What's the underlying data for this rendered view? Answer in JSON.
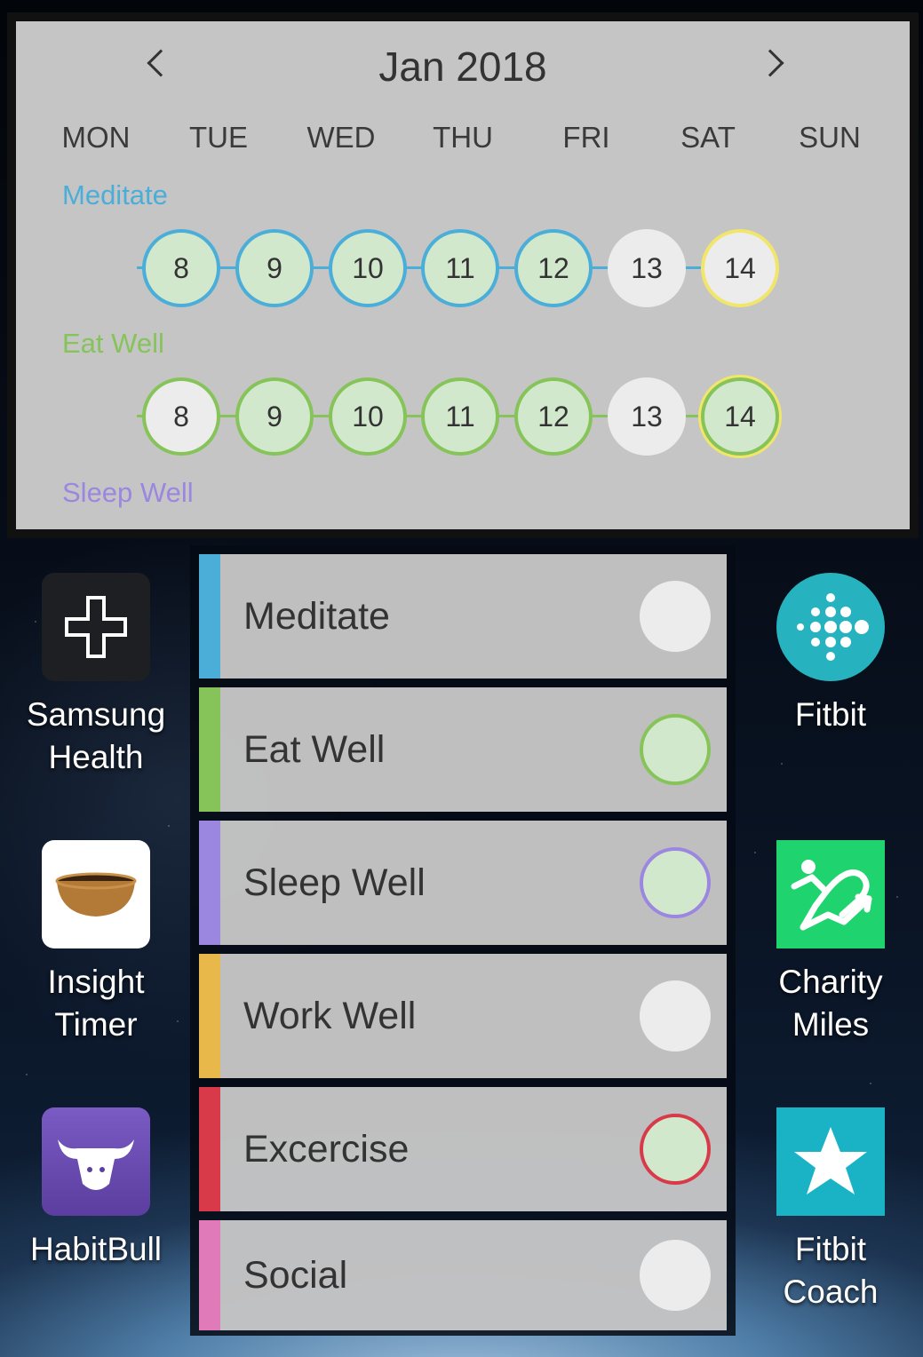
{
  "calendar": {
    "month_label": "Jan 2018",
    "weekdays": [
      "MON",
      "TUE",
      "WED",
      "THU",
      "FRI",
      "SAT",
      "SUN"
    ],
    "habits": [
      {
        "name": "Meditate",
        "color": "#4aaed8",
        "days": [
          {
            "n": "8",
            "done": true
          },
          {
            "n": "9",
            "done": true
          },
          {
            "n": "10",
            "done": true
          },
          {
            "n": "11",
            "done": true
          },
          {
            "n": "12",
            "done": true
          },
          {
            "n": "13",
            "done": false
          },
          {
            "n": "14",
            "done": false,
            "today": true
          }
        ]
      },
      {
        "name": "Eat Well",
        "color": "#86c45a",
        "days": [
          {
            "n": "8",
            "done": false
          },
          {
            "n": "9",
            "done": true
          },
          {
            "n": "10",
            "done": true
          },
          {
            "n": "11",
            "done": true
          },
          {
            "n": "12",
            "done": true
          },
          {
            "n": "13",
            "done": false
          },
          {
            "n": "14",
            "done": true,
            "today": true
          }
        ]
      },
      {
        "name": "Sleep Well",
        "color": "#9b86e0",
        "days": []
      }
    ],
    "today_color": "#f1e66b"
  },
  "apps_left": [
    {
      "label_lines": [
        "Samsung",
        "Health"
      ],
      "icon": "plus-icon"
    },
    {
      "label_lines": [
        "Insight",
        "Timer"
      ],
      "icon": "singing-bowl-icon"
    },
    {
      "label_lines": [
        "HabitBull"
      ],
      "icon": "bull-icon"
    }
  ],
  "apps_right": [
    {
      "label_lines": [
        "Fitbit"
      ],
      "icon": "fitbit-dots-icon"
    },
    {
      "label_lines": [
        "Charity",
        "Miles"
      ],
      "icon": "runner-heart-icon"
    },
    {
      "label_lines": [
        "Fitbit",
        "Coach"
      ],
      "icon": "star-icon"
    }
  ],
  "habit_list": [
    {
      "name": "Meditate",
      "color": "#4aaed8",
      "done": false
    },
    {
      "name": "Eat Well",
      "color": "#86c45a",
      "done": true
    },
    {
      "name": "Sleep Well",
      "color": "#9b86e0",
      "done": true
    },
    {
      "name": "Work Well",
      "color": "#e8b94a",
      "done": false
    },
    {
      "name": "Excercise",
      "color": "#d83a4a",
      "done": true
    },
    {
      "name": "Social",
      "color": "#e07ab8",
      "done": false
    }
  ],
  "done_fill": "#d2e8cd",
  "undone_fill": "#ececec"
}
